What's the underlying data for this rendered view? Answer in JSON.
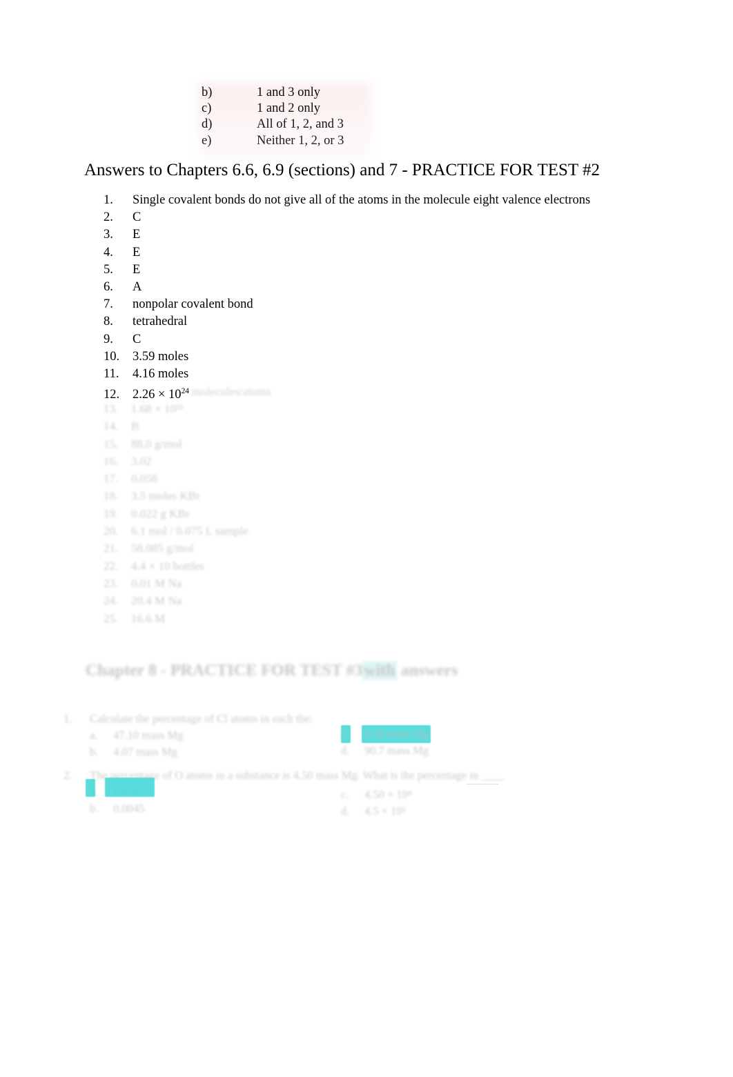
{
  "document": {
    "mc_fragment": {
      "options": [
        {
          "letter": "b)",
          "text": "1 and 3 only"
        },
        {
          "letter": "c)",
          "text": "1 and 2 only"
        },
        {
          "letter": "d)",
          "text": "All of 1, 2, and 3"
        },
        {
          "letter": "e)",
          "text": "Neither 1, 2, or 3"
        }
      ]
    },
    "heading": "Answers to Chapters 6.6, 6.9 (sections) and 7 - PRACTICE FOR TEST #2",
    "answers": [
      {
        "num": "1.",
        "text": "Single covalent bonds do not give all of the atoms in the molecule eight valence electrons"
      },
      {
        "num": "2.",
        "text": "C"
      },
      {
        "num": "3.",
        "text": "E"
      },
      {
        "num": "4.",
        "text": "E"
      },
      {
        "num": "5.",
        "text": "E"
      },
      {
        "num": "6.",
        "text": "A"
      },
      {
        "num": "7.",
        "text": "nonpolar covalent bond"
      },
      {
        "num": "8.",
        "text": "tetrahedral"
      },
      {
        "num": "9.",
        "text": "C"
      },
      {
        "num": "10.",
        "text": "3.59 moles"
      },
      {
        "num": "11.",
        "text": "4.16 moles"
      }
    ],
    "answer_12": {
      "num": "12.",
      "text": "2.26 × 10",
      "exponent": "24",
      "tail": "molecules/atoms"
    },
    "faded_answers": [
      {
        "num": "13.",
        "text": "1.68 × 10²³"
      },
      {
        "num": "14.",
        "text": "B"
      },
      {
        "num": "15.",
        "text": "88.0 g/mol"
      },
      {
        "num": "16.",
        "text": "3.02"
      },
      {
        "num": "17.",
        "text": "0.058"
      },
      {
        "num": "18.",
        "text": "3.5 moles KBr"
      },
      {
        "num": "19.",
        "text": "0.022 g KBr"
      },
      {
        "num": "20.",
        "text": "6.1 mol / 0.075 L sample"
      },
      {
        "num": "21.",
        "text": "58.085 g/mol"
      },
      {
        "num": "22.",
        "text": "4.4 × 10 bottles"
      },
      {
        "num": "23.",
        "text": "0.01 M Na"
      },
      {
        "num": "24.",
        "text": "20.4 M Na"
      },
      {
        "num": "25.",
        "text": "16.6 M"
      }
    ],
    "section2_heading": {
      "before": "Chapter 8 - PRACTICE FOR TEST #3",
      "highlight": "with",
      "after": " answers"
    },
    "questions": [
      {
        "num": "1.",
        "stem": "Calculate the percentage of Cl atoms in each the:",
        "options_left": [
          {
            "letter": "a.",
            "text": "47.10 mass Mg"
          },
          {
            "letter": "b.",
            "text": "4.07 mass Mg"
          }
        ],
        "options_right": [
          {
            "letter": "c.",
            "text": "9.30 mass Mg"
          },
          {
            "letter": "d.",
            "text": "90.7 mass Mg"
          }
        ]
      },
      {
        "num": "2.",
        "stem": "The percentage of O atoms in a substance is 4.50 mass Mg. What is the percentage in ____",
        "options_left": [
          {
            "letter": "a.",
            "text": "0.050"
          },
          {
            "letter": "b.",
            "text": "0.0045"
          }
        ],
        "options_right": [
          {
            "letter": "c.",
            "text": "4.50 × 10⁴"
          },
          {
            "letter": "d.",
            "text": "4.5 × 10²"
          }
        ]
      }
    ],
    "colors": {
      "highlight_teal": "#3fd6d6",
      "text": "#000000",
      "faded_text": "#bdbaba"
    }
  }
}
